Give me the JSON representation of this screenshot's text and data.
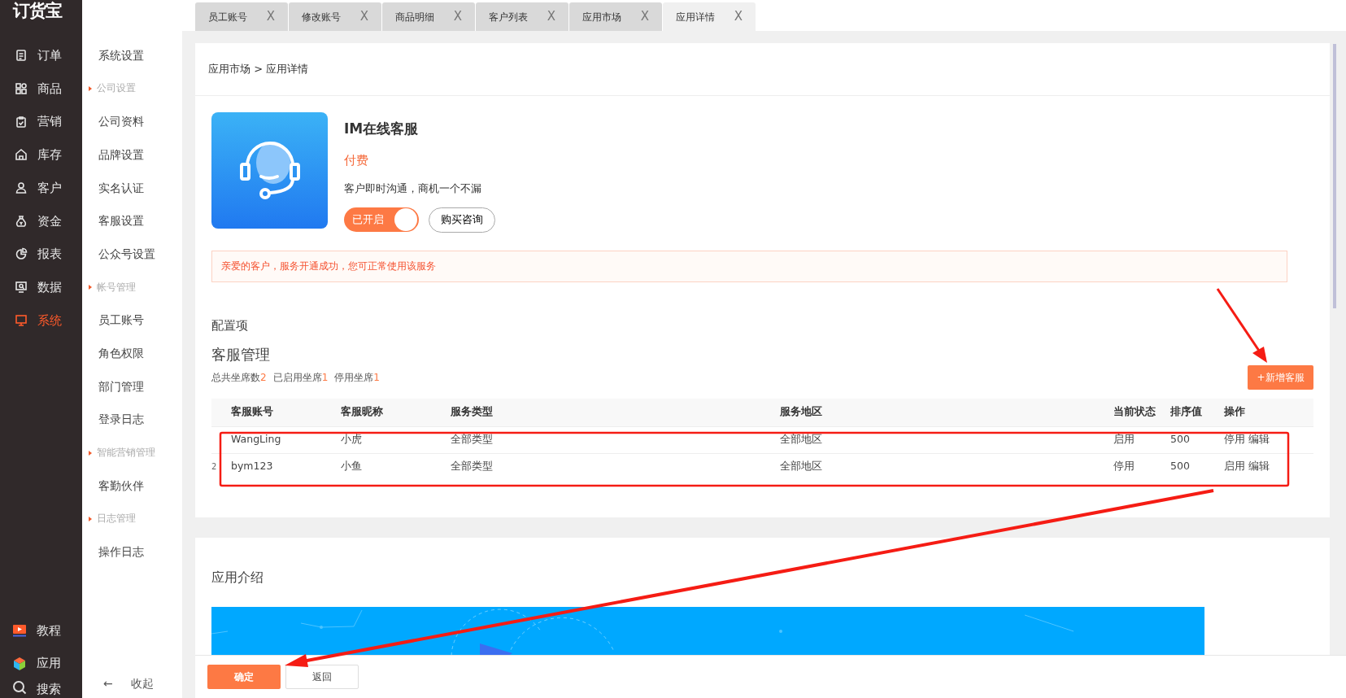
{
  "logo": "订货宝",
  "nav": [
    {
      "label": "订单",
      "selected": false
    },
    {
      "label": "商品",
      "selected": false
    },
    {
      "label": "营销",
      "selected": false
    },
    {
      "label": "库存",
      "selected": false
    },
    {
      "label": "客户",
      "selected": false
    },
    {
      "label": "资金",
      "selected": false
    },
    {
      "label": "报表",
      "selected": false
    },
    {
      "label": "数据",
      "selected": false
    },
    {
      "label": "系统",
      "selected": true
    }
  ],
  "nav_bottom": [
    {
      "label": "教程"
    },
    {
      "label": "应用"
    },
    {
      "label": "搜索"
    }
  ],
  "subnav": [
    {
      "label": "系统设置",
      "kind": "item"
    },
    {
      "label": "公司设置",
      "kind": "header"
    },
    {
      "label": "公司资料",
      "kind": "item"
    },
    {
      "label": "品牌设置",
      "kind": "item"
    },
    {
      "label": "实名认证",
      "kind": "item"
    },
    {
      "label": "客服设置",
      "kind": "item"
    },
    {
      "label": "公众号设置",
      "kind": "item"
    },
    {
      "label": "帐号管理",
      "kind": "header"
    },
    {
      "label": "员工账号",
      "kind": "item"
    },
    {
      "label": "角色权限",
      "kind": "item"
    },
    {
      "label": "部门管理",
      "kind": "item"
    },
    {
      "label": "登录日志",
      "kind": "item"
    },
    {
      "label": "智能营销管理",
      "kind": "header"
    },
    {
      "label": "客勤伙伴",
      "kind": "item"
    },
    {
      "label": "日志管理",
      "kind": "header"
    },
    {
      "label": "操作日志",
      "kind": "item"
    }
  ],
  "collapse": {
    "arrow": "←",
    "label": "收起"
  },
  "tabs": [
    {
      "label": "员工账号",
      "close": "X",
      "selected": false
    },
    {
      "label": "修改账号",
      "close": "X",
      "selected": false
    },
    {
      "label": "商品明细",
      "close": "X",
      "selected": false
    },
    {
      "label": "客户列表",
      "close": "X",
      "selected": false
    },
    {
      "label": "应用市场",
      "close": "X",
      "selected": false
    },
    {
      "label": "应用详情",
      "close": "X",
      "selected": true
    }
  ],
  "breadcrumb": "应用市场 > 应用详情",
  "app": {
    "title": "IM在线客服",
    "price": "付费",
    "description": "客户即时沟通，商机一个不漏",
    "toggle": {
      "label": "已开启",
      "on": true
    },
    "consult_button": "购买咨询"
  },
  "alert": "亲爱的客户，服务开通成功，您可正常使用该服务",
  "config_label": "配置项",
  "section_title": "客服管理",
  "stats": [
    {
      "label": "总共坐席数",
      "value": "2"
    },
    {
      "label": "已启用坐席",
      "value": "1"
    },
    {
      "label": "停用坐席",
      "value": "1"
    }
  ],
  "add_button": "+新增客服",
  "table": {
    "columns": [
      "客服账号",
      "客服昵称",
      "服务类型",
      "服务地区",
      "当前状态",
      "排序值",
      "操作"
    ],
    "rows": [
      {
        "cells": [
          "WangLing",
          "小虎",
          "全部类型",
          "全部地区",
          "启用",
          "500"
        ],
        "actions": [
          "停用",
          "编辑"
        ]
      },
      {
        "row_number": "2",
        "cells": [
          "bym123",
          "小鱼",
          "全部类型",
          "全部地区",
          "停用",
          "500"
        ],
        "actions": [
          "启用",
          "编辑"
        ]
      }
    ]
  },
  "intro_title": "应用介绍",
  "footer_buttons": [
    {
      "label": "确定",
      "kind": "primary"
    },
    {
      "label": "返回",
      "kind": "default"
    }
  ]
}
